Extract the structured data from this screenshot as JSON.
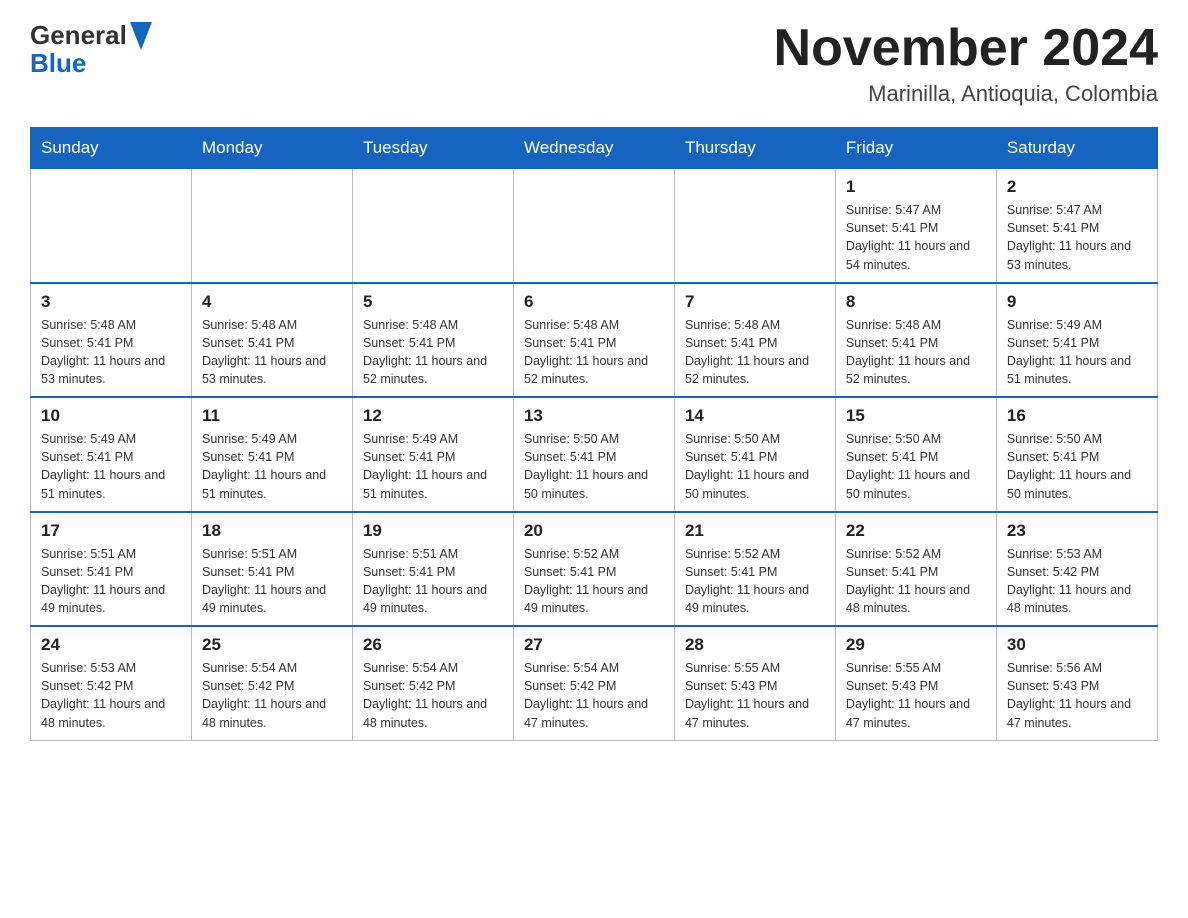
{
  "header": {
    "logo_general": "General",
    "logo_blue": "Blue",
    "title": "November 2024",
    "subtitle": "Marinilla, Antioquia, Colombia"
  },
  "days_of_week": [
    "Sunday",
    "Monday",
    "Tuesday",
    "Wednesday",
    "Thursday",
    "Friday",
    "Saturday"
  ],
  "weeks": [
    [
      {
        "day": "",
        "info": ""
      },
      {
        "day": "",
        "info": ""
      },
      {
        "day": "",
        "info": ""
      },
      {
        "day": "",
        "info": ""
      },
      {
        "day": "",
        "info": ""
      },
      {
        "day": "1",
        "info": "Sunrise: 5:47 AM\nSunset: 5:41 PM\nDaylight: 11 hours and 54 minutes."
      },
      {
        "day": "2",
        "info": "Sunrise: 5:47 AM\nSunset: 5:41 PM\nDaylight: 11 hours and 53 minutes."
      }
    ],
    [
      {
        "day": "3",
        "info": "Sunrise: 5:48 AM\nSunset: 5:41 PM\nDaylight: 11 hours and 53 minutes."
      },
      {
        "day": "4",
        "info": "Sunrise: 5:48 AM\nSunset: 5:41 PM\nDaylight: 11 hours and 53 minutes."
      },
      {
        "day": "5",
        "info": "Sunrise: 5:48 AM\nSunset: 5:41 PM\nDaylight: 11 hours and 52 minutes."
      },
      {
        "day": "6",
        "info": "Sunrise: 5:48 AM\nSunset: 5:41 PM\nDaylight: 11 hours and 52 minutes."
      },
      {
        "day": "7",
        "info": "Sunrise: 5:48 AM\nSunset: 5:41 PM\nDaylight: 11 hours and 52 minutes."
      },
      {
        "day": "8",
        "info": "Sunrise: 5:48 AM\nSunset: 5:41 PM\nDaylight: 11 hours and 52 minutes."
      },
      {
        "day": "9",
        "info": "Sunrise: 5:49 AM\nSunset: 5:41 PM\nDaylight: 11 hours and 51 minutes."
      }
    ],
    [
      {
        "day": "10",
        "info": "Sunrise: 5:49 AM\nSunset: 5:41 PM\nDaylight: 11 hours and 51 minutes."
      },
      {
        "day": "11",
        "info": "Sunrise: 5:49 AM\nSunset: 5:41 PM\nDaylight: 11 hours and 51 minutes."
      },
      {
        "day": "12",
        "info": "Sunrise: 5:49 AM\nSunset: 5:41 PM\nDaylight: 11 hours and 51 minutes."
      },
      {
        "day": "13",
        "info": "Sunrise: 5:50 AM\nSunset: 5:41 PM\nDaylight: 11 hours and 50 minutes."
      },
      {
        "day": "14",
        "info": "Sunrise: 5:50 AM\nSunset: 5:41 PM\nDaylight: 11 hours and 50 minutes."
      },
      {
        "day": "15",
        "info": "Sunrise: 5:50 AM\nSunset: 5:41 PM\nDaylight: 11 hours and 50 minutes."
      },
      {
        "day": "16",
        "info": "Sunrise: 5:50 AM\nSunset: 5:41 PM\nDaylight: 11 hours and 50 minutes."
      }
    ],
    [
      {
        "day": "17",
        "info": "Sunrise: 5:51 AM\nSunset: 5:41 PM\nDaylight: 11 hours and 49 minutes."
      },
      {
        "day": "18",
        "info": "Sunrise: 5:51 AM\nSunset: 5:41 PM\nDaylight: 11 hours and 49 minutes."
      },
      {
        "day": "19",
        "info": "Sunrise: 5:51 AM\nSunset: 5:41 PM\nDaylight: 11 hours and 49 minutes."
      },
      {
        "day": "20",
        "info": "Sunrise: 5:52 AM\nSunset: 5:41 PM\nDaylight: 11 hours and 49 minutes."
      },
      {
        "day": "21",
        "info": "Sunrise: 5:52 AM\nSunset: 5:41 PM\nDaylight: 11 hours and 49 minutes."
      },
      {
        "day": "22",
        "info": "Sunrise: 5:52 AM\nSunset: 5:41 PM\nDaylight: 11 hours and 48 minutes."
      },
      {
        "day": "23",
        "info": "Sunrise: 5:53 AM\nSunset: 5:42 PM\nDaylight: 11 hours and 48 minutes."
      }
    ],
    [
      {
        "day": "24",
        "info": "Sunrise: 5:53 AM\nSunset: 5:42 PM\nDaylight: 11 hours and 48 minutes."
      },
      {
        "day": "25",
        "info": "Sunrise: 5:54 AM\nSunset: 5:42 PM\nDaylight: 11 hours and 48 minutes."
      },
      {
        "day": "26",
        "info": "Sunrise: 5:54 AM\nSunset: 5:42 PM\nDaylight: 11 hours and 48 minutes."
      },
      {
        "day": "27",
        "info": "Sunrise: 5:54 AM\nSunset: 5:42 PM\nDaylight: 11 hours and 47 minutes."
      },
      {
        "day": "28",
        "info": "Sunrise: 5:55 AM\nSunset: 5:43 PM\nDaylight: 11 hours and 47 minutes."
      },
      {
        "day": "29",
        "info": "Sunrise: 5:55 AM\nSunset: 5:43 PM\nDaylight: 11 hours and 47 minutes."
      },
      {
        "day": "30",
        "info": "Sunrise: 5:56 AM\nSunset: 5:43 PM\nDaylight: 11 hours and 47 minutes."
      }
    ]
  ]
}
